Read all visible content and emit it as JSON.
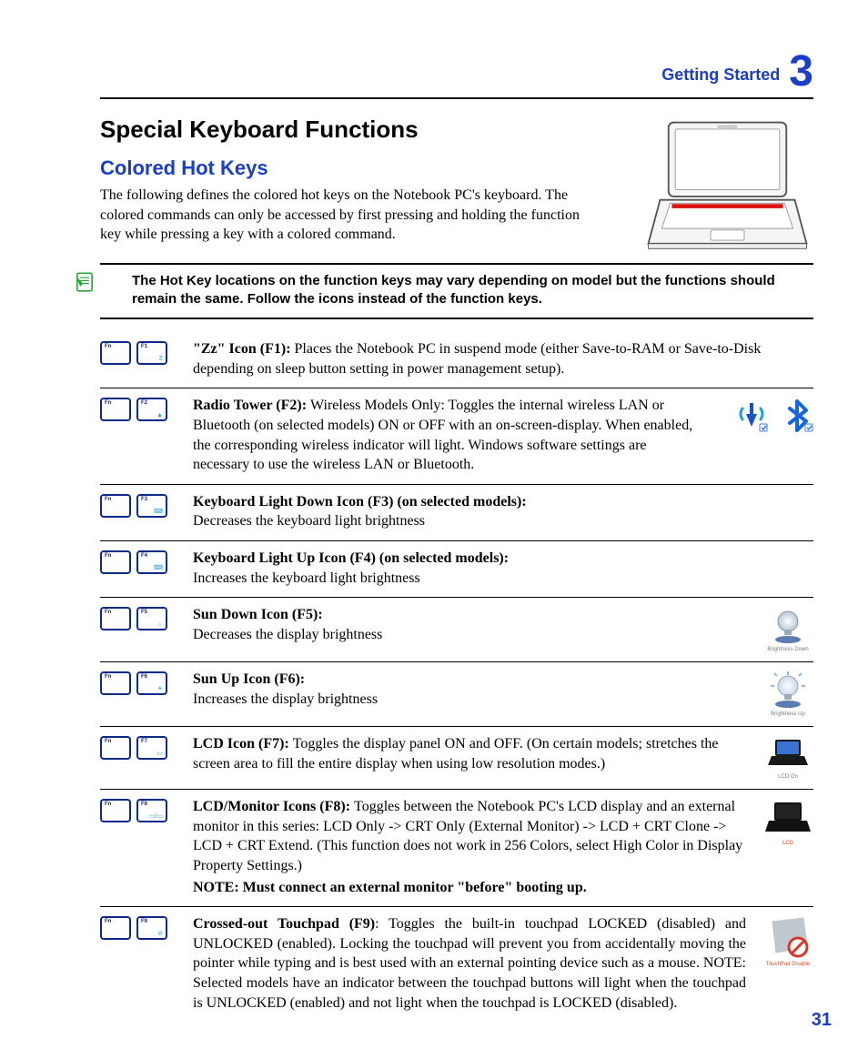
{
  "header": {
    "section": "Getting Started",
    "chapter_number": "3"
  },
  "title": "Special Keyboard Functions",
  "subtitle": "Colored Hot Keys",
  "intro": "The following defines the colored hot keys on the Notebook PC's keyboard. The colored commands can only be accessed by first pressing and holding the function key while pressing a key with a colored command.",
  "note": "The Hot Key locations on the function keys may vary depending on model but the functions should remain the same. Follow the icons instead of the function keys.",
  "fn_label": "Fn",
  "rows": [
    {
      "key": "F1",
      "glyph": "Z",
      "title": "\"Zz\" Icon (F1): ",
      "body": "Places the Notebook PC in suspend mode (either Save-to-RAM or Save-to-Disk depending on sleep button setting in power management setup)."
    },
    {
      "key": "F2",
      "glyph": "▲",
      "title": "Radio Tower (F2): ",
      "body": "Wireless Models Only: Toggles the internal wireless LAN or Bluetooth (on selected models) ON or OFF with an on-screen-display. When enabled, the corresponding wireless indicator will light. Windows software settings are necessary to use the wireless LAN or Bluetooth."
    },
    {
      "key": "F3",
      "glyph": "⌨",
      "title": "Keyboard Light Down Icon (F3) (on selected models):",
      "body": "Decreases the keyboard light brightness"
    },
    {
      "key": "F4",
      "glyph": "⌨",
      "title": "Keyboard Light Up Icon (F4) (on selected models):",
      "body": "Increases the keyboard light brightness"
    },
    {
      "key": "F5",
      "glyph": "☼",
      "title": "Sun Down Icon (F5):",
      "body": "Decreases the display brightness"
    },
    {
      "key": "F6",
      "glyph": "☀",
      "title": "Sun Up Icon (F6):",
      "body": "Increases the display brightness"
    },
    {
      "key": "F7",
      "glyph": "▭",
      "title": "LCD Icon (F7): ",
      "body": "Toggles the display panel ON and OFF. (On certain models; stretches the screen area to fill the entire display when using low resolution modes.)"
    },
    {
      "key": "F8",
      "glyph": "▭/▭",
      "title": "LCD/Monitor Icons (F8): ",
      "body": "Toggles between the Notebook PC's LCD display and an external monitor in this series: LCD Only -> CRT Only (External Monitor) -> LCD + CRT Clone -> LCD + CRT Extend. (This function does not work in 256 Colors, select High Color in Display Property Settings.)",
      "subnote": "NOTE: Must connect an external monitor \"before\" booting up."
    },
    {
      "key": "F9",
      "glyph": "⊘",
      "title": "Crossed-out Touchpad (F9)",
      "body": ": Toggles the built-in touchpad LOCKED (disabled) and UNLOCKED (enabled). Locking the touchpad will prevent you from accidentally moving the pointer while typing and is best used with an external pointing device such as a mouse. NOTE: Selected models have an indicator between the touchpad buttons will light when the touchpad is UNLOCKED (enabled) and not light when the touchpad is LOCKED (disabled)."
    }
  ],
  "side": {
    "brightness_down": "Brightness Down",
    "brightness_up": "Brightness Up",
    "lcd_on": "LCD On",
    "lcd": "LCD",
    "tp_disable": "TouchPad Disable"
  },
  "page_number": "31"
}
